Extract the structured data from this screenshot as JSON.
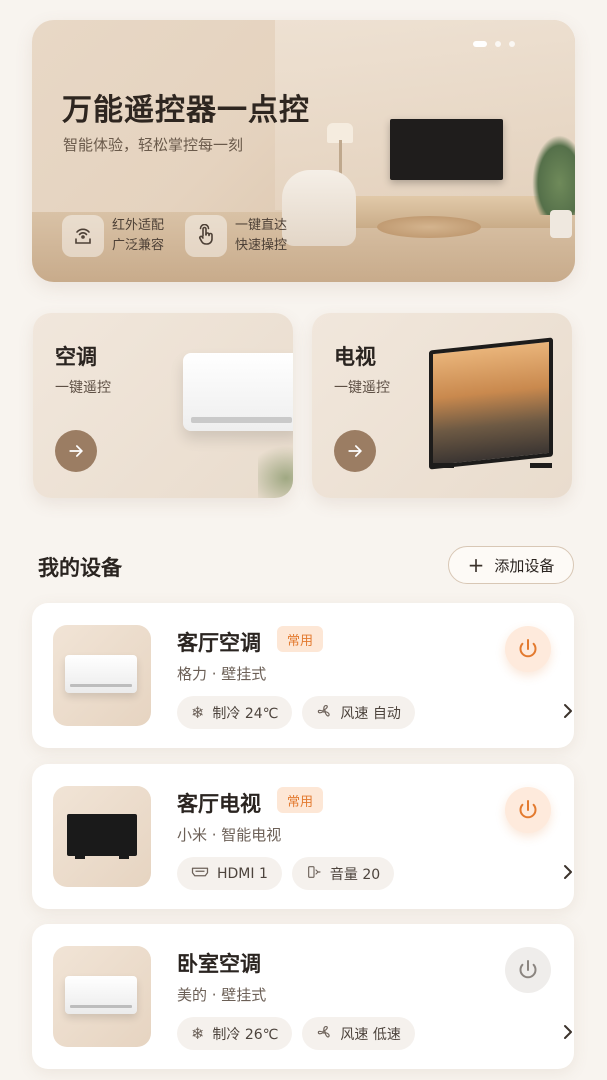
{
  "hero": {
    "title": "万能遥控器一点控",
    "subtitle": "智能体验，轻松掌控每一刻",
    "features": [
      {
        "icon": "infrared-icon",
        "line1": "红外适配",
        "line2": "广泛兼容"
      },
      {
        "icon": "tap-hand-icon",
        "line1": "一键直达",
        "line2": "快速操控"
      }
    ],
    "pager": {
      "total": 3,
      "active": 1
    }
  },
  "quick": [
    {
      "title": "空调",
      "subtitle": "一键遥控",
      "icon": "arrow-right-icon"
    },
    {
      "title": "电视",
      "subtitle": "一键遥控",
      "icon": "arrow-right-icon"
    }
  ],
  "devices_section": {
    "title": "我的设备",
    "add_label": "添加设备"
  },
  "devices": [
    {
      "name": "客厅空调",
      "badge": "常用",
      "model": "格力 · 壁挂式",
      "type": "ac",
      "power": "on",
      "chips": [
        {
          "icon": "snowflake-icon",
          "text": "制冷 24℃"
        },
        {
          "icon": "fan-icon",
          "text": "风速  自动"
        }
      ]
    },
    {
      "name": "客厅电视",
      "badge": "常用",
      "model": "小米 · 智能电视",
      "type": "tv",
      "power": "on",
      "chips": [
        {
          "icon": "hdmi-icon",
          "text": "HDMI 1"
        },
        {
          "icon": "volume-icon",
          "text": "音量 20"
        }
      ]
    },
    {
      "name": "卧室空调",
      "badge": "",
      "model": "美的 · 壁挂式",
      "type": "ac",
      "power": "off",
      "chips": [
        {
          "icon": "snowflake-icon",
          "text": "制冷 26℃"
        },
        {
          "icon": "fan-icon",
          "text": "风速  低速"
        }
      ]
    }
  ],
  "colors": {
    "accent": "#e37a2f",
    "badge_bg": "#fde7d6",
    "quick_button": "#9b7d63",
    "background": "#f8f4ef"
  }
}
